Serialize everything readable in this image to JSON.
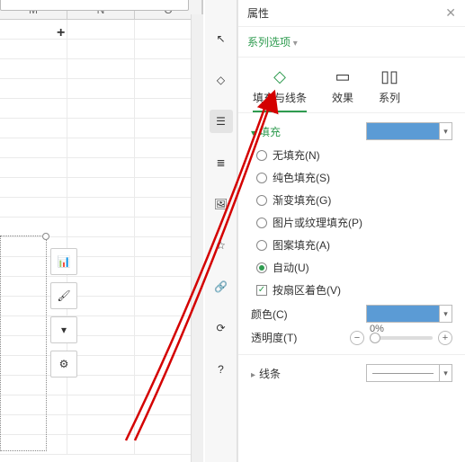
{
  "sheet": {
    "columns": [
      "M",
      "N",
      "O"
    ]
  },
  "panel": {
    "title": "属性",
    "series_dropdown": "系列选项",
    "tabs": {
      "fill": "填充与线条",
      "effects": "效果",
      "series": "系列"
    },
    "fill_section": {
      "title": "填充",
      "options": {
        "none": "无填充(N)",
        "solid": "纯色填充(S)",
        "gradient": "渐变填充(G)",
        "picture": "图片或纹理填充(P)",
        "pattern": "图案填充(A)",
        "auto": "自动(U)"
      },
      "vary_colors": "按扇区着色(V)",
      "color_label": "颜色(C)",
      "transparency_label": "透明度(T)",
      "transparency_value": "0%"
    },
    "line_section": {
      "title": "线条"
    }
  }
}
